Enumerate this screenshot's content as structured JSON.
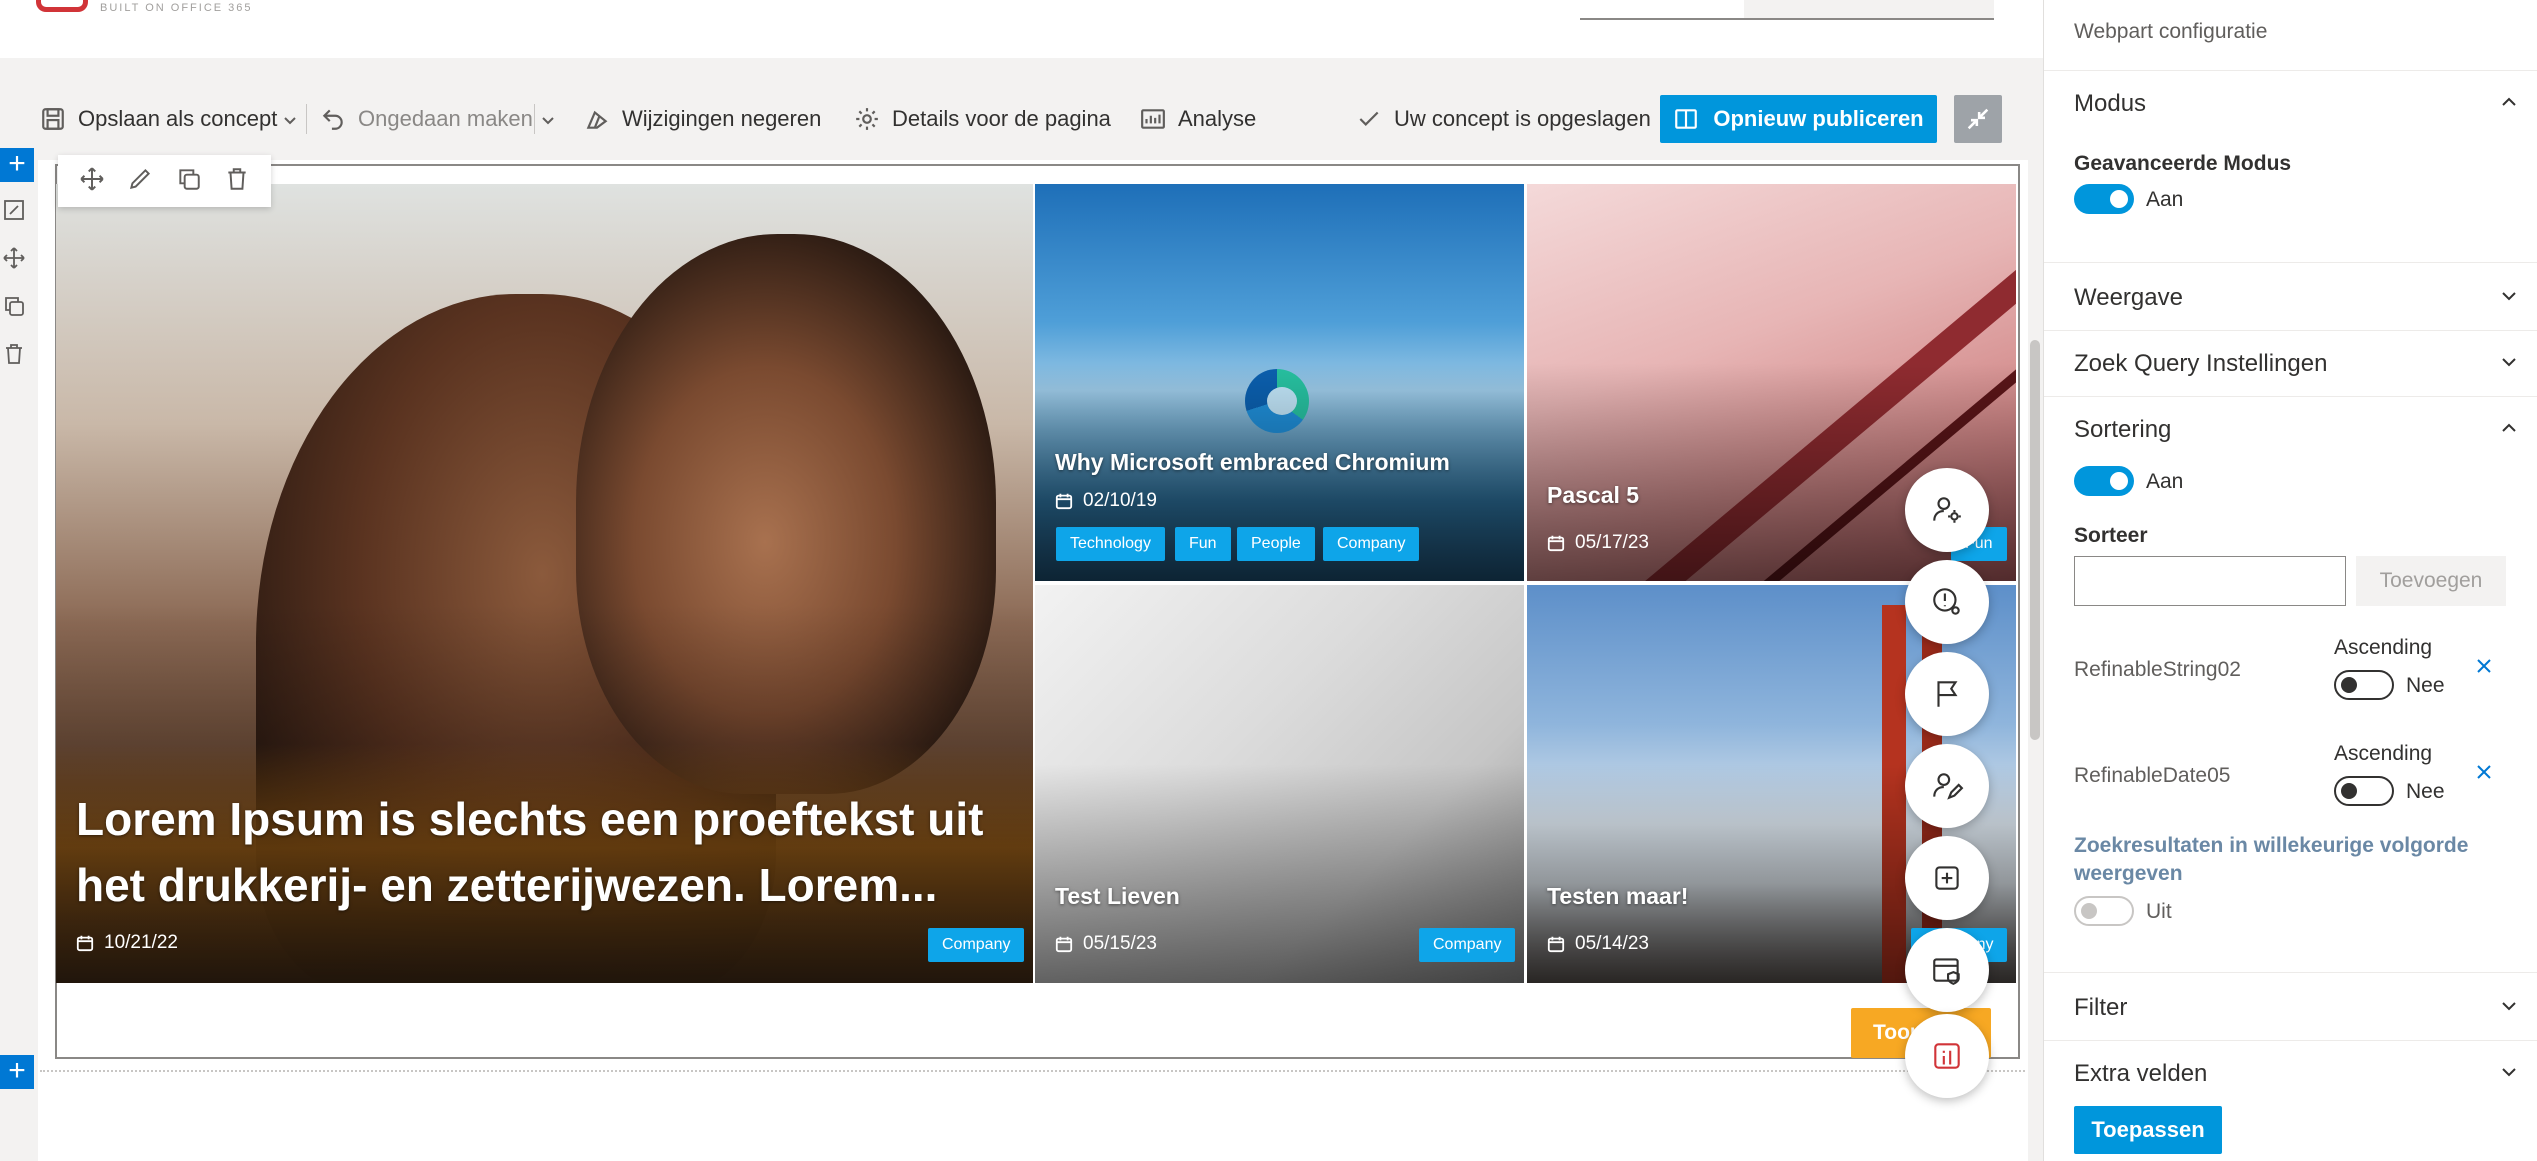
{
  "header": {
    "tagline": "BUILT ON OFFICE 365"
  },
  "toolbar": {
    "save_draft": "Opslaan als concept",
    "undo": "Ongedaan maken",
    "discard": "Wijzigingen negeren",
    "page_details": "Details voor de pagina",
    "analytics": "Analyse",
    "saved_status": "Uw concept is opgeslagen",
    "republish": "Opnieuw publiceren"
  },
  "tiles": {
    "main": {
      "title": "Lorem Ipsum is slechts een proeftekst uit het drukkerij- en zetterijwezen. Lorem...",
      "date": "10/21/22",
      "tag": "Company"
    },
    "edge": {
      "title": "Why Microsoft embraced Chromium",
      "date": "02/10/19",
      "tags": [
        "Technology",
        "Fun",
        "People",
        "Company"
      ]
    },
    "pascal": {
      "title": "Pascal 5",
      "date": "05/17/23",
      "tag": "Fun"
    },
    "lieven": {
      "title": "Test Lieven",
      "date": "05/15/23",
      "tag": "Company"
    },
    "testen": {
      "title": "Testen maar!",
      "date": "05/14/23",
      "tag": "Company"
    }
  },
  "more_button": "Toon meer",
  "panel": {
    "title": "Webpart configuratie",
    "sections": {
      "modus": "Modus",
      "weergave": "Weergave",
      "zoek_query": "Zoek Query Instellingen",
      "sortering": "Sortering",
      "filter": "Filter",
      "extra_velden": "Extra velden"
    },
    "advanced_mode_label": "Geavanceerde Modus",
    "advanced_mode_value": "Aan",
    "sort_enabled_value": "Aan",
    "sort_label": "Sorteer",
    "sort_add": "Toevoegen",
    "sort_fields": [
      {
        "field": "RefinableString02",
        "direction_label": "Ascending",
        "value": "Nee"
      },
      {
        "field": "RefinableDate05",
        "direction_label": "Ascending",
        "value": "Nee"
      }
    ],
    "random_label": "Zoekresultaten in willekeurige volgorde weergeven",
    "random_value": "Uit",
    "apply": "Toepassen"
  },
  "colors": {
    "accent": "#0096dc",
    "tag": "#0ea5e9",
    "more_button": "#f7a823",
    "brand_red": "#d13438"
  },
  "icons": [
    "save-icon",
    "undo-icon",
    "discard-icon",
    "gear-icon",
    "analytics-icon",
    "check-icon",
    "publish-icon",
    "collapse-icon",
    "move-icon",
    "edit-icon",
    "duplicate-icon",
    "delete-icon",
    "calendar-icon",
    "user-settings-icon",
    "alert-settings-icon",
    "flag-icon",
    "user-edit-icon",
    "add-icon",
    "calendar-security-icon",
    "brand-icon",
    "chevron-up-icon",
    "chevron-down-icon",
    "close-icon"
  ]
}
